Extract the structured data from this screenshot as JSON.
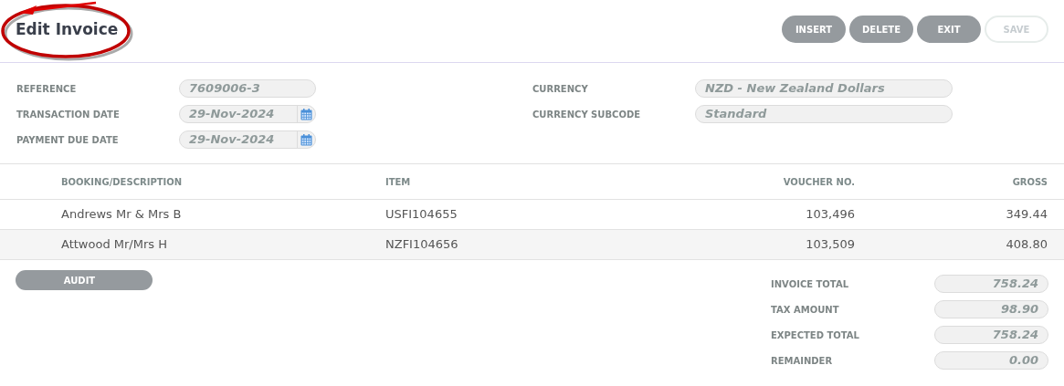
{
  "title": "Edit Invoice",
  "toolbar": [
    {
      "label": "INSERT",
      "disabled": false
    },
    {
      "label": "DELETE",
      "disabled": false
    },
    {
      "label": "EXIT",
      "disabled": false
    },
    {
      "label": "SAVE",
      "disabled": true
    }
  ],
  "form_left": [
    {
      "label": "REFERENCE",
      "value": "7609006-3",
      "kind": "text"
    },
    {
      "label": "TRANSACTION DATE",
      "value": "29-Nov-2024",
      "kind": "date"
    },
    {
      "label": "PAYMENT DUE DATE",
      "value": "29-Nov-2024",
      "kind": "date"
    }
  ],
  "form_right": [
    {
      "label": "CURRENCY",
      "value": "NZD - New Zealand Dollars"
    },
    {
      "label": "CURRENCY SUBCODE",
      "value": "Standard"
    }
  ],
  "table": {
    "columns": [
      "BOOKING/DESCRIPTION",
      "ITEM",
      "VOUCHER NO.",
      "GROSS"
    ],
    "rows": [
      [
        "Andrews Mr & Mrs B",
        "USFI104655",
        "103,496",
        "349.44"
      ],
      [
        "Attwood Mr/Mrs H",
        "NZFI104656",
        "103,509",
        "408.80"
      ]
    ]
  },
  "audit_button": "AUDIT",
  "totals": [
    {
      "label": "INVOICE TOTAL",
      "value": "758.24"
    },
    {
      "label": "TAX AMOUNT",
      "value": "98.90"
    },
    {
      "label": "EXPECTED TOTAL",
      "value": "758.24"
    },
    {
      "label": "REMAINDER",
      "value": "0.00"
    }
  ]
}
